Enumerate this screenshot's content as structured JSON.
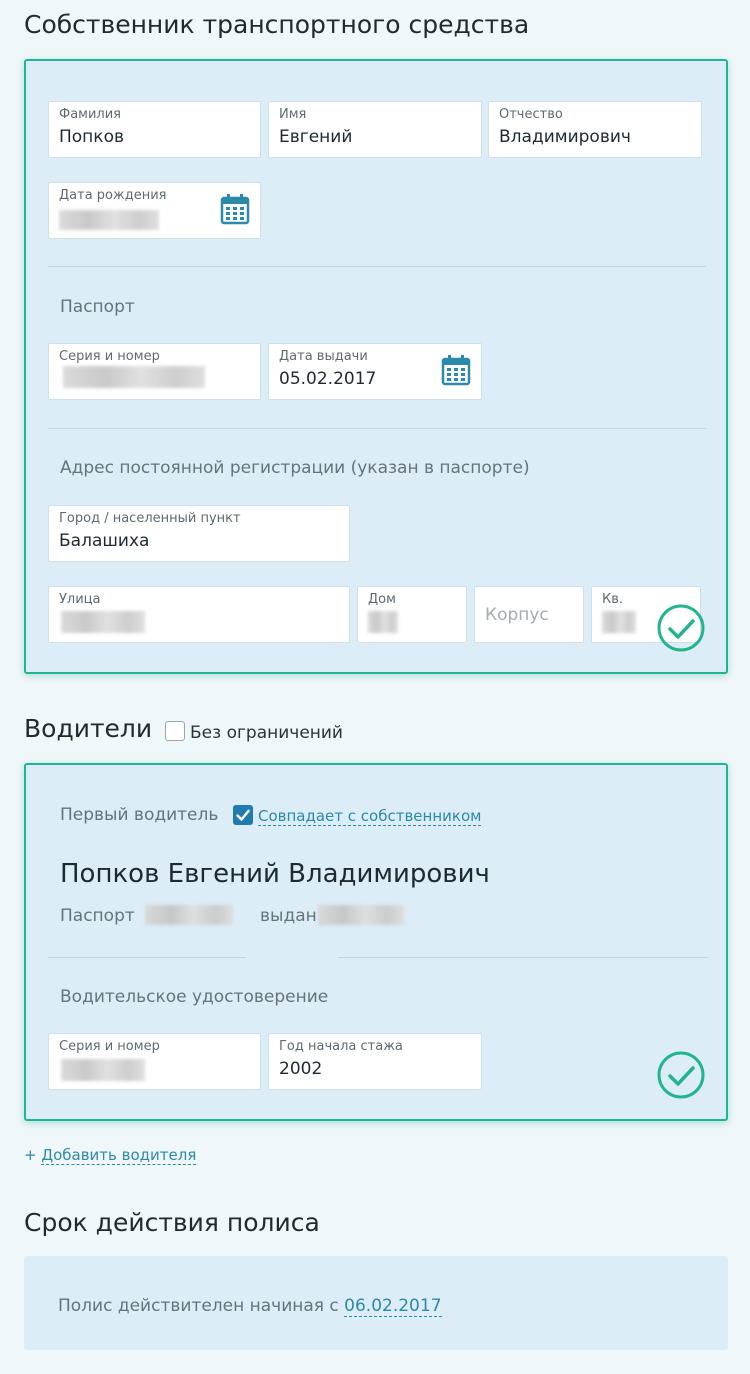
{
  "owner": {
    "title": "Собственник транспортного средства",
    "last_name": {
      "label": "Фамилия",
      "value": "Попков"
    },
    "first_name": {
      "label": "Имя",
      "value": "Евгений"
    },
    "patronymic": {
      "label": "Отчество",
      "value": "Владимирович"
    },
    "birth_date": {
      "label": "Дата рождения"
    },
    "passport_heading": "Паспорт",
    "passport_number": {
      "label": "Серия и номер"
    },
    "passport_issue_date": {
      "label": "Дата выдачи",
      "value": "05.02.2017"
    },
    "address_heading": "Адрес постоянной регистрации (указан в паспорте)",
    "city": {
      "label": "Город / населенный пункт",
      "value": "Балашиха"
    },
    "street": {
      "label": "Улица"
    },
    "house": {
      "label": "Дом"
    },
    "building": {
      "placeholder": "Корпус"
    },
    "apartment": {
      "label": "Кв."
    }
  },
  "drivers": {
    "title": "Водители",
    "no_limits_label": "Без ограничений",
    "no_limits_checked": false,
    "first_driver_label": "Первый водитель",
    "same_as_owner_label": "Совпадает с собственником",
    "same_as_owner_checked": true,
    "driver_name": "Попков Евгений Владимирович",
    "passport_label": "Паспорт",
    "issued_label": "выдан",
    "license_heading": "Водительское удостоверение",
    "license_number": {
      "label": "Серия и номер"
    },
    "experience_start": {
      "label": "Год начала стажа",
      "value": "2002"
    },
    "add_driver_plus": "+",
    "add_driver_label": "Добавить водителя"
  },
  "policy": {
    "title": "Срок действия полиса",
    "valid_from_text": "Полис действителен начиная с",
    "valid_from_date": "06.02.2017"
  },
  "colors": {
    "accent": "#22b48e",
    "link": "#2a8aa8",
    "panel_bg": "#dcedf7",
    "checkbox": "#1f7bb0"
  },
  "icons": [
    "calendar-icon",
    "check-circle-icon",
    "checkbox-icon"
  ]
}
